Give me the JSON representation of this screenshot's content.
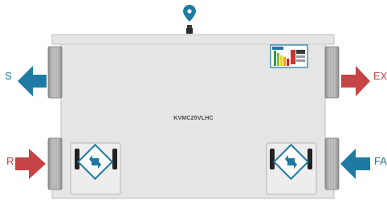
{
  "unit": {
    "model": "KVMC25VLHC"
  },
  "ports": {
    "top_left": {
      "label": "S",
      "arrow_color": "#1e7aa3",
      "direction": "left"
    },
    "bottom_left": {
      "label": "R",
      "arrow_color": "#c64446",
      "direction": "right"
    },
    "top_right": {
      "label": "EX",
      "arrow_color": "#c64446",
      "direction": "right"
    },
    "bottom_right": {
      "label": "FA",
      "arrow_color": "#1e7aa3",
      "direction": "left"
    }
  },
  "colors": {
    "body": "#e4e4e4",
    "body_outline": "#b9b9b9",
    "collar": "#9a9a9a",
    "supply_blue": "#1e7aa3",
    "exhaust_red": "#c64446",
    "label_blue": "#1e7aa3",
    "label_red": "#c64446",
    "marker": "#1e7aa3"
  },
  "icons": {
    "top_marker": "map-pin-icon",
    "energy_label": "energy-rating-label-icon",
    "service_panel_left": "filter-access-icon",
    "service_panel_right": "filter-access-icon"
  }
}
